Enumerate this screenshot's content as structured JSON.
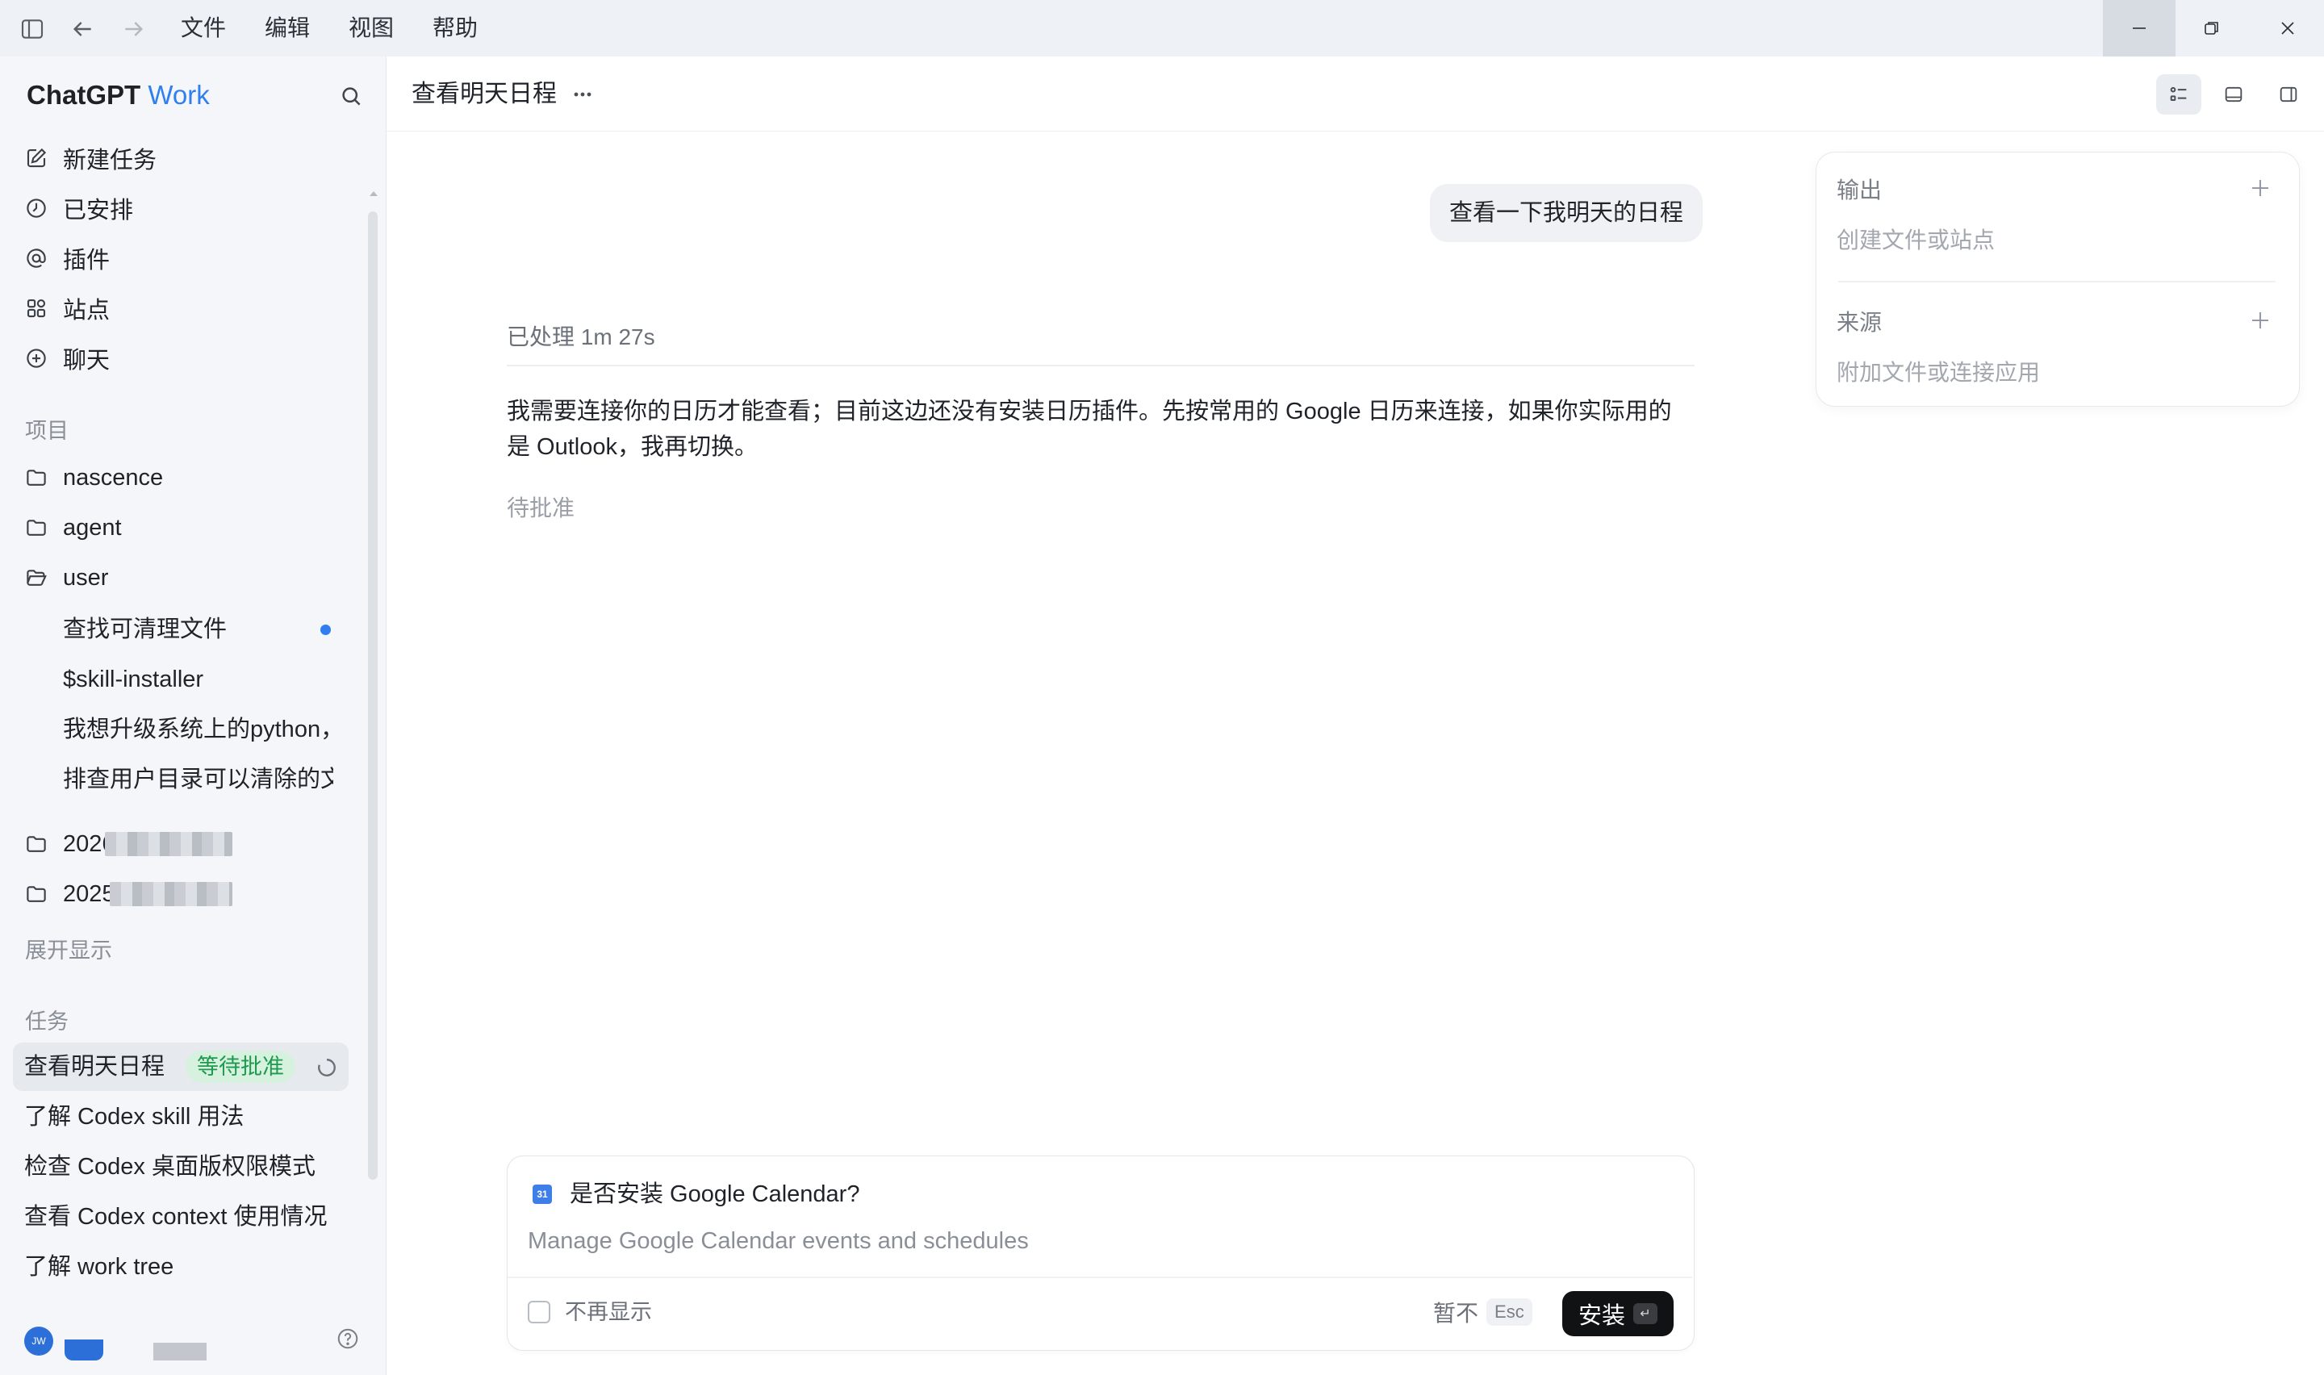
{
  "menu": {
    "file": "文件",
    "edit": "编辑",
    "view": "视图",
    "help": "帮助"
  },
  "brand": {
    "name": "ChatGPT",
    "suffix": "Work"
  },
  "nav": [
    {
      "label": "新建任务",
      "icon": "edit-icon"
    },
    {
      "label": "已安排",
      "icon": "clock-icon"
    },
    {
      "label": "插件",
      "icon": "at-icon"
    },
    {
      "label": "站点",
      "icon": "apps-icon"
    },
    {
      "label": "聊天",
      "icon": "plus-circle-icon"
    }
  ],
  "projects": {
    "label": "项目",
    "items": [
      "nascence",
      "agent",
      "user"
    ],
    "user_children": [
      "查找可清理文件",
      "$skill-installer",
      "我想升级系统上的python，",
      "排查用户目录可以清除的文件"
    ],
    "blurred": [
      "2026",
      "2025"
    ],
    "expand": "展开显示"
  },
  "tasks": {
    "label": "任务",
    "items": [
      "查看明天日程",
      "了解 Codex skill 用法",
      "检查 Codex 桌面版权限模式",
      "查看 Codex context 使用情况",
      "了解 work tree"
    ],
    "active_badge": "等待批准"
  },
  "user": {
    "initials": "JW"
  },
  "chat": {
    "title": "查看明天日程",
    "user_message": "查看一下我明天的日程",
    "processed": "已处理 1m 27s",
    "assistant_message": "我需要连接你的日历才能查看；目前这边还没有安装日历插件。先按常用的 Google 日历来连接，如果你实际用的是 Outlook，我再切换。",
    "status": "待批准"
  },
  "side_panel": {
    "output_title": "输出",
    "output_sub": "创建文件或站点",
    "source_title": "来源",
    "source_sub": "附加文件或连接应用"
  },
  "dialog": {
    "icon_text": "31",
    "title": "是否安装 Google Calendar?",
    "description": "Manage Google Calendar events and schedules",
    "checkbox_label": "不再显示",
    "skip_label": "暂不",
    "skip_key": "Esc",
    "install_label": "安装",
    "install_key": "↵"
  },
  "colors": {
    "accent": "#2f7ff0",
    "badge_bg": "#d6f2df",
    "badge_text": "#1e9a4f",
    "primary_button": "#111214"
  }
}
